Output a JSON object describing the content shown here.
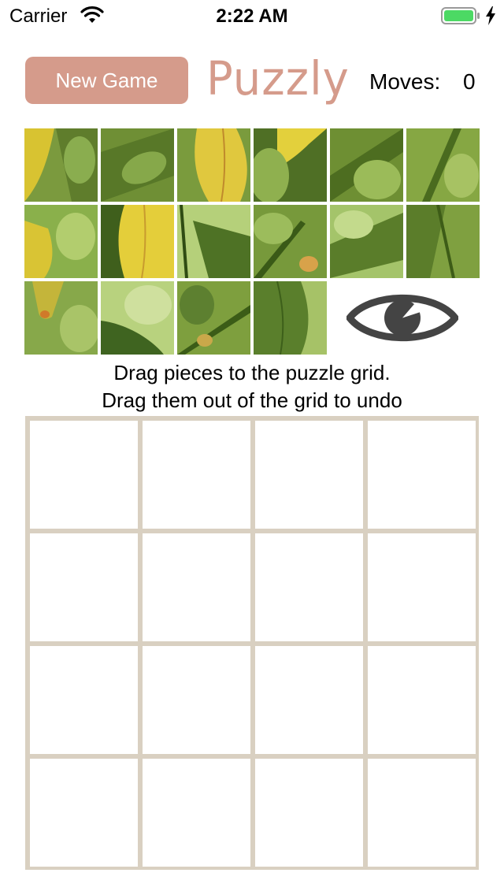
{
  "status_bar": {
    "carrier": "Carrier",
    "time": "2:22 AM",
    "battery_color": "#4cd964",
    "icons": [
      "wifi-icon",
      "battery-icon",
      "charging-bolt-icon"
    ]
  },
  "header": {
    "new_game_label": "New Game",
    "app_logo": "Puzzly",
    "moves_label": "Moves:",
    "moves_value": "0"
  },
  "colors": {
    "accent": "#d59b8b",
    "grid_line": "#d9d0c1",
    "eye_icon": "#444444"
  },
  "tray": {
    "piece_count": 16,
    "preview_icon": "eye-icon"
  },
  "instructions": {
    "line1": "Drag pieces to the puzzle grid.",
    "line2": "Drag them out of the grid to undo"
  },
  "grid": {
    "rows": 4,
    "columns": 4,
    "filled_cells": 0
  }
}
